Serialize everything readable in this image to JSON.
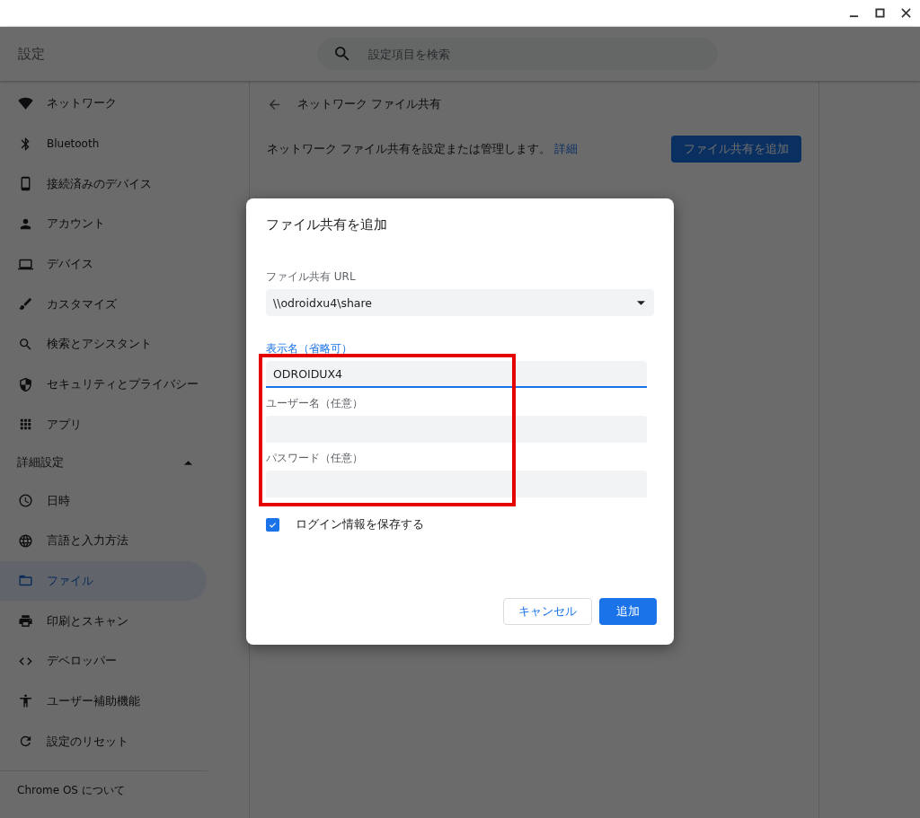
{
  "app": {
    "title": "設定"
  },
  "search": {
    "placeholder": "設定項目を検索"
  },
  "sidebar": {
    "items": [
      {
        "label": "ネットワーク",
        "selected": false
      },
      {
        "label": "Bluetooth",
        "selected": false
      },
      {
        "label": "接続済みのデバイス",
        "selected": false
      },
      {
        "label": "アカウント",
        "selected": false
      },
      {
        "label": "デバイス",
        "selected": false
      },
      {
        "label": "カスタマイズ",
        "selected": false
      },
      {
        "label": "検索とアシスタント",
        "selected": false
      },
      {
        "label": "セキュリティとプライバシー",
        "selected": false
      },
      {
        "label": "アプリ",
        "selected": false
      }
    ],
    "advanced": {
      "label": "詳細設定",
      "expanded": true,
      "items": [
        {
          "label": "日時",
          "selected": false
        },
        {
          "label": "言語と入力方法",
          "selected": false
        },
        {
          "label": "ファイル",
          "selected": true
        },
        {
          "label": "印刷とスキャン",
          "selected": false
        },
        {
          "label": "デベロッパー",
          "selected": false
        },
        {
          "label": "ユーザー補助機能",
          "selected": false
        },
        {
          "label": "設定のリセット",
          "selected": false
        }
      ]
    },
    "about": "Chrome OS について"
  },
  "page": {
    "title": "ネットワーク ファイル共有",
    "description": "ネットワーク ファイル共有を設定または管理します。",
    "link": "詳細",
    "add_button": "ファイル共有を追加"
  },
  "dialog": {
    "title": "ファイル共有を追加",
    "fields": [
      {
        "kind": "dropdown",
        "label": "ファイル共有 URL",
        "value": "\\\\odroidxu4\\share"
      },
      {
        "kind": "text",
        "label": "表示名（省略可）",
        "value": "ODROIDUX4",
        "focused": true
      },
      {
        "kind": "text",
        "label": "ユーザー名（任意）",
        "focused": false
      },
      {
        "kind": "password",
        "label": "パスワード（任意）",
        "focused": false
      }
    ],
    "checkbox": {
      "label": "ログイン情報を保存する",
      "checked": true
    },
    "buttons": [
      {
        "label": "キャンセル",
        "kind": "secondary"
      },
      {
        "label": "追加",
        "kind": "primary"
      }
    ]
  }
}
